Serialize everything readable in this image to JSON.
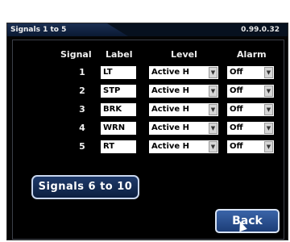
{
  "header": {
    "title": "Signals 1 to 5",
    "version": "0.99.0.32"
  },
  "table": {
    "columns": {
      "signal": "Signal",
      "label": "Label",
      "level": "Level",
      "alarm": "Alarm"
    },
    "rows": [
      {
        "signal": "1",
        "label": "LT",
        "level": "Active H",
        "alarm": "Off"
      },
      {
        "signal": "2",
        "label": "STP",
        "level": "Active H",
        "alarm": "Off"
      },
      {
        "signal": "3",
        "label": "BRK",
        "level": "Active H",
        "alarm": "Off"
      },
      {
        "signal": "4",
        "label": "WRN",
        "level": "Active H",
        "alarm": "Off"
      },
      {
        "signal": "5",
        "label": "RT",
        "level": "Active H",
        "alarm": "Off"
      }
    ]
  },
  "buttons": {
    "next_page": "Signals 6 to 10",
    "back": "Back"
  },
  "icons": {
    "dropdown": "▼"
  }
}
